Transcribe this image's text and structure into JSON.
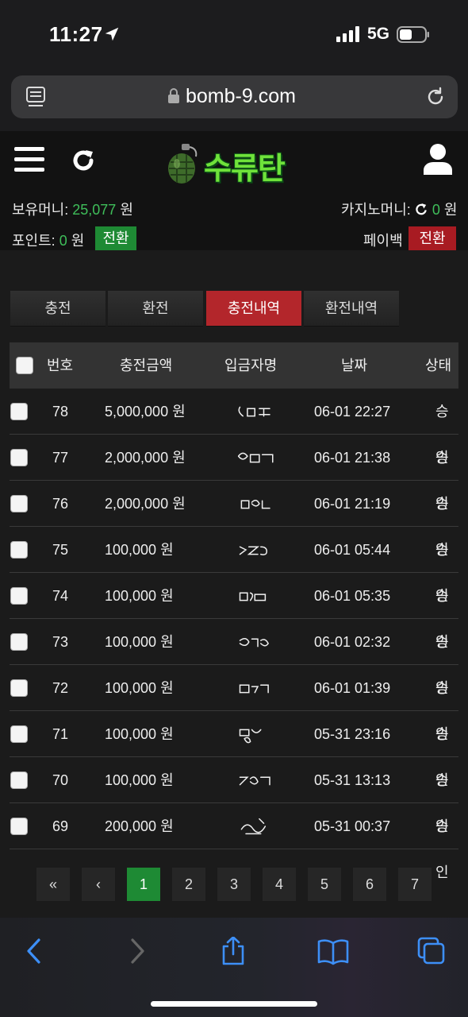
{
  "status_bar": {
    "time": "11:27",
    "network": "5G"
  },
  "browser": {
    "url": "bomb-9.com"
  },
  "site": {
    "logo_text": "수류탄",
    "holding_money_label": "보유머니:",
    "holding_money_value": "25,077",
    "holding_money_unit": "원",
    "casino_money_label": "카지노머니:",
    "casino_money_value": "0",
    "casino_money_unit": "원",
    "points_label": "포인트:",
    "points_value": "0",
    "points_unit": "원",
    "convert_button": "전환",
    "payback_label": "페이백",
    "payback_button": "전환"
  },
  "tabs": [
    {
      "label": "충전"
    },
    {
      "label": "환전"
    },
    {
      "label": "충전내역",
      "active": true
    },
    {
      "label": "환전내역"
    }
  ],
  "table": {
    "headers": {
      "number": "번호",
      "amount": "충전금액",
      "depositor": "입금자명",
      "date": "날짜",
      "status": "상태"
    },
    "rows": [
      {
        "number": "78",
        "amount": "5,000,000 원",
        "date": "06-01 22:27",
        "status": "승인"
      },
      {
        "number": "77",
        "amount": "2,000,000 원",
        "date": "06-01 21:38",
        "status": "승인"
      },
      {
        "number": "76",
        "amount": "2,000,000 원",
        "date": "06-01 21:19",
        "status": "승인"
      },
      {
        "number": "75",
        "amount": "100,000 원",
        "date": "06-01 05:44",
        "status": "승인"
      },
      {
        "number": "74",
        "amount": "100,000 원",
        "date": "06-01 05:35",
        "status": "승인"
      },
      {
        "number": "73",
        "amount": "100,000 원",
        "date": "06-01 02:32",
        "status": "승인"
      },
      {
        "number": "72",
        "amount": "100,000 원",
        "date": "06-01 01:39",
        "status": "승인"
      },
      {
        "number": "71",
        "amount": "100,000 원",
        "date": "05-31 23:16",
        "status": "승인"
      },
      {
        "number": "70",
        "amount": "100,000 원",
        "date": "05-31 13:13",
        "status": "승인"
      },
      {
        "number": "69",
        "amount": "200,000 원",
        "date": "05-31 00:37",
        "status": "승인"
      }
    ]
  },
  "pagination": {
    "first": "«",
    "prev": "‹",
    "pages": [
      "1",
      "2",
      "3",
      "4",
      "5",
      "6",
      "7"
    ],
    "current_page": "1"
  },
  "colors": {
    "accent_green": "#1e8a34",
    "accent_red": "#a81b22",
    "value_green": "#3fbf5a"
  }
}
